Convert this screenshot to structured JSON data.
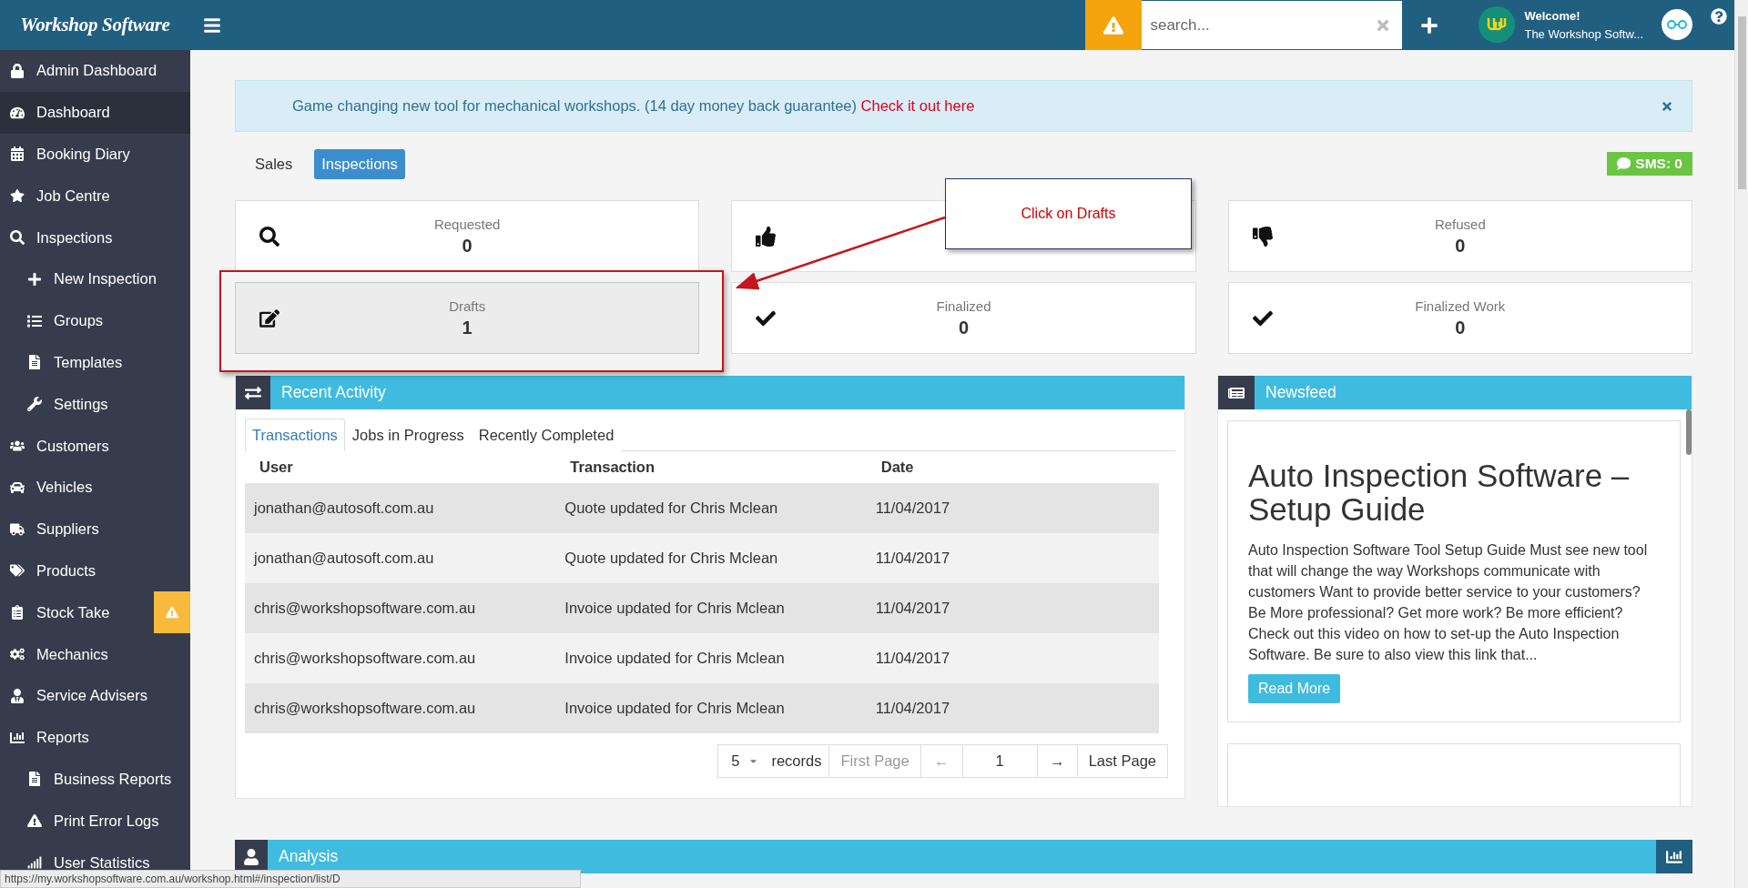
{
  "top_bar": {
    "logo": "Workshop Software",
    "search": {
      "placeholder": "search..."
    },
    "welcome": "Welcome!",
    "user_name": "The Workshop Softw..."
  },
  "sidebar": {
    "items": [
      {
        "label": "Admin Dashboard",
        "selected": false
      },
      {
        "label": "Dashboard",
        "selected": true
      },
      {
        "label": "Booking Diary",
        "selected": false
      },
      {
        "label": "Job Centre",
        "selected": false
      },
      {
        "label": "Inspections",
        "selected": false,
        "children": [
          {
            "label": "New Inspection",
            "selected": false
          },
          {
            "label": "Groups",
            "selected": false
          },
          {
            "label": "Templates",
            "selected": false
          },
          {
            "label": "Settings",
            "selected": false
          }
        ]
      },
      {
        "label": "Customers",
        "selected": false
      },
      {
        "label": "Vehicles",
        "selected": false
      },
      {
        "label": "Suppliers",
        "selected": false
      },
      {
        "label": "Products",
        "selected": false
      },
      {
        "label": "Stock Take",
        "selected": false,
        "alert": true
      },
      {
        "label": "Mechanics",
        "selected": false
      },
      {
        "label": "Service Advisers",
        "selected": false
      },
      {
        "label": "Reports",
        "selected": false,
        "children": [
          {
            "label": "Business Reports",
            "selected": false
          },
          {
            "label": "Print Error Logs",
            "selected": false
          },
          {
            "label": "User Statistics",
            "selected": false
          }
        ]
      }
    ]
  },
  "banner": {
    "text": "Game changing new tool for mechanical workshops. (14 day money back guarantee) ",
    "link": "Check it out here"
  },
  "view_tabs": [
    {
      "label": "Sales",
      "selected": false
    },
    {
      "label": "Inspections",
      "selected": true
    }
  ],
  "sms_badge": "SMS: 0",
  "stat_cards": [
    {
      "label": "Requested",
      "value": "0",
      "highlighted": false
    },
    {
      "highlighted": false
    },
    {
      "label": "Refused",
      "value": "0",
      "highlighted": false
    },
    {
      "label": "Drafts",
      "value": "1",
      "highlighted": true
    },
    {
      "label": "Finalized",
      "value": "0",
      "highlighted": false
    },
    {
      "label": "Finalized Work",
      "value": "0",
      "highlighted": false
    }
  ],
  "recent_activity": {
    "title": "Recent Activity",
    "tabs": [
      {
        "label": "Transactions",
        "selected": true
      },
      {
        "label": "Jobs in Progress",
        "selected": false
      },
      {
        "label": "Recently Completed",
        "selected": false
      }
    ],
    "columns": [
      "User",
      "Transaction",
      "Date"
    ],
    "rows": [
      [
        "jonathan@autosoft.com.au",
        "Quote updated for Chris Mclean",
        "11/04/2017"
      ],
      [
        "jonathan@autosoft.com.au",
        "Quote updated for Chris Mclean",
        "11/04/2017"
      ],
      [
        "chris@workshopsoftware.com.au",
        "Invoice updated for Chris Mclean",
        "11/04/2017"
      ],
      [
        "chris@workshopsoftware.com.au",
        "Invoice updated for Chris Mclean",
        "11/04/2017"
      ],
      [
        "chris@workshopsoftware.com.au",
        "Invoice updated for Chris Mclean",
        "11/04/2017"
      ]
    ],
    "pagination": {
      "page_size": "5",
      "records": "records",
      "first": "First Page",
      "prev": "←",
      "page": "1",
      "next": "→",
      "last": "Last Page"
    }
  },
  "newsfeed": {
    "title": "Newsfeed",
    "articles": [
      {
        "title": "Auto Inspection Software – Setup Guide",
        "body": "Auto Inspection Software Tool Setup Guide Must see new tool that will change the way Workshops communicate with customers Want to provide better service to your customers? Be More professional? Get more work? Be more efficient? Check out this video on how to set-up the Auto Inspection Software. Be sure to also view this link that...",
        "button": "Read More"
      }
    ]
  },
  "analysis": {
    "title": "Analysis"
  },
  "annotation": {
    "callout": "Click on Drafts"
  },
  "status_url": "https://my.workshopsoftware.com.au/workshop.html#/inspection/list/D"
}
